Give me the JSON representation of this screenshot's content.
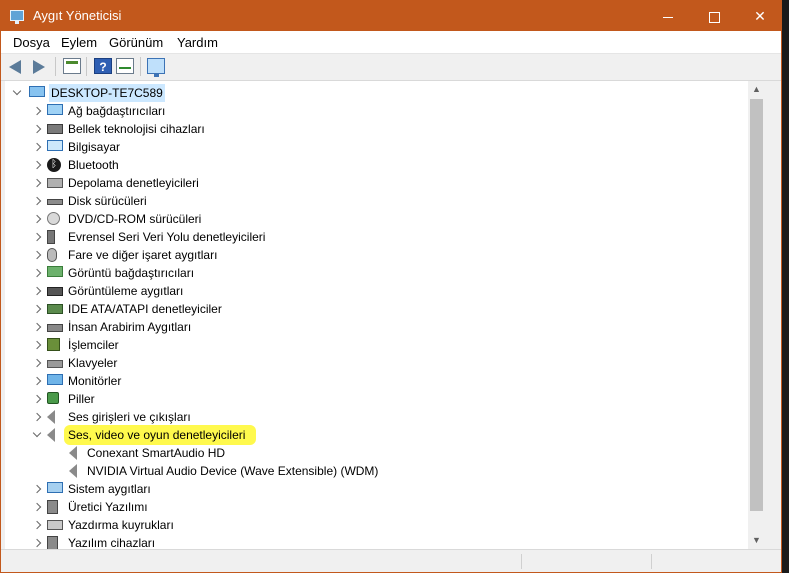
{
  "window": {
    "title": "Aygıt Yöneticisi"
  },
  "menubar": [
    "Dosya",
    "Eylem",
    "Görünüm",
    "Yardım"
  ],
  "toolbar": {
    "help_label": "?"
  },
  "tree": {
    "root": "DESKTOP-TE7C589",
    "categories": [
      {
        "label": "Ağ bağdaştırıcıları",
        "icon": "network-adapter-icon"
      },
      {
        "label": "Bellek teknolojisi cihazları",
        "icon": "memory-chip-icon"
      },
      {
        "label": "Bilgisayar",
        "icon": "computer-icon"
      },
      {
        "label": "Bluetooth",
        "icon": "bluetooth-icon"
      },
      {
        "label": "Depolama denetleyicileri",
        "icon": "storage-controller-icon"
      },
      {
        "label": "Disk sürücüleri",
        "icon": "disk-drive-icon"
      },
      {
        "label": "DVD/CD-ROM sürücüleri",
        "icon": "dvd-icon"
      },
      {
        "label": "Evrensel Seri Veri Yolu denetleyicileri",
        "icon": "usb-icon"
      },
      {
        "label": "Fare ve diğer işaret aygıtları",
        "icon": "mouse-icon"
      },
      {
        "label": "Görüntü bağdaştırıcıları",
        "icon": "display-adapter-icon"
      },
      {
        "label": "Görüntüleme aygıtları",
        "icon": "camera-icon"
      },
      {
        "label": "IDE ATA/ATAPI denetleyiciler",
        "icon": "ide-controller-icon"
      },
      {
        "label": "İnsan Arabirim Aygıtları",
        "icon": "hid-icon"
      },
      {
        "label": "İşlemciler",
        "icon": "processor-icon"
      },
      {
        "label": "Klavyeler",
        "icon": "keyboard-icon"
      },
      {
        "label": "Monitörler",
        "icon": "monitor-icon"
      },
      {
        "label": "Piller",
        "icon": "battery-icon"
      },
      {
        "label": "Ses girişleri ve çıkışları",
        "icon": "audio-io-icon"
      },
      {
        "label": "Ses, video ve oyun denetleyicileri",
        "icon": "sound-controller-icon",
        "expanded": true
      },
      {
        "label": "Sistem aygıtları",
        "icon": "system-device-icon"
      },
      {
        "label": "Üretici Yazılımı",
        "icon": "firmware-icon"
      },
      {
        "label": "Yazdırma kuyrukları",
        "icon": "print-queue-icon"
      },
      {
        "label": "Yazılım cihazları",
        "icon": "software-device-icon"
      }
    ],
    "children": [
      "Conexant SmartAudio HD",
      "NVIDIA Virtual Audio Device (Wave Extensible) (WDM)"
    ]
  },
  "colors": {
    "titlebar": "#c2581c",
    "highlight": "#fff94d"
  }
}
